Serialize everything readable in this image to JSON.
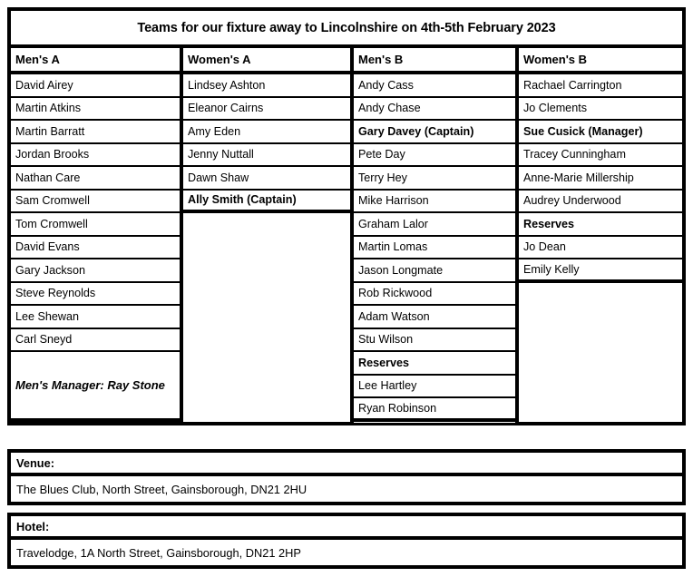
{
  "document": {
    "title": "Teams for our fixture away to Lincolnshire on 4th-5th February 2023"
  },
  "teams_table": {
    "columns": [
      {
        "header": "Men's A",
        "entries": [
          {
            "text": "David Airey",
            "bold": false
          },
          {
            "text": "Martin Atkins",
            "bold": false
          },
          {
            "text": "Martin Barratt",
            "bold": false
          },
          {
            "text": "Jordan Brooks",
            "bold": false
          },
          {
            "text": "Nathan Care",
            "bold": false
          },
          {
            "text": "Sam Cromwell",
            "bold": false
          },
          {
            "text": "Tom Cromwell",
            "bold": false
          },
          {
            "text": "David Evans",
            "bold": false
          },
          {
            "text": "Gary Jackson",
            "bold": false
          },
          {
            "text": "Steve Reynolds",
            "bold": false
          },
          {
            "text": "Lee Shewan",
            "bold": false
          },
          {
            "text": "Carl Sneyd",
            "bold": false
          }
        ],
        "manager_note": "Men's Manager: Ray Stone"
      },
      {
        "header": "Women's A",
        "entries": [
          {
            "text": "Lindsey Ashton",
            "bold": false
          },
          {
            "text": "Eleanor Cairns",
            "bold": false
          },
          {
            "text": "Amy Eden",
            "bold": false
          },
          {
            "text": "Jenny Nuttall",
            "bold": false
          },
          {
            "text": "Dawn Shaw",
            "bold": false
          },
          {
            "text": "Ally Smith (Captain)",
            "bold": true
          }
        ],
        "manager_note": null
      },
      {
        "header": "Men's B",
        "entries": [
          {
            "text": "Andy Cass",
            "bold": false
          },
          {
            "text": "Andy Chase",
            "bold": false
          },
          {
            "text": "Gary Davey (Captain)",
            "bold": true
          },
          {
            "text": "Pete Day",
            "bold": false
          },
          {
            "text": "Terry Hey",
            "bold": false
          },
          {
            "text": "Mike Harrison",
            "bold": false
          },
          {
            "text": "Graham Lalor",
            "bold": false
          },
          {
            "text": "Martin Lomas",
            "bold": false
          },
          {
            "text": "Jason Longmate",
            "bold": false
          },
          {
            "text": "Rob Rickwood",
            "bold": false
          },
          {
            "text": "Adam Watson",
            "bold": false
          },
          {
            "text": "Stu Wilson",
            "bold": false
          },
          {
            "text": "Reserves",
            "bold": true
          },
          {
            "text": "Lee Hartley",
            "bold": false
          },
          {
            "text": "Ryan Robinson",
            "bold": false
          }
        ],
        "manager_note": null
      },
      {
        "header": "Women's B",
        "entries": [
          {
            "text": "Rachael Carrington",
            "bold": false
          },
          {
            "text": "Jo Clements",
            "bold": false
          },
          {
            "text": "Sue Cusick (Manager)",
            "bold": true
          },
          {
            "text": "Tracey Cunningham",
            "bold": false
          },
          {
            "text": "Anne-Marie Millership",
            "bold": false
          },
          {
            "text": "Audrey Underwood",
            "bold": false
          },
          {
            "text": "Reserves",
            "bold": true
          },
          {
            "text": "Jo Dean",
            "bold": false
          },
          {
            "text": "Emily Kelly",
            "bold": false
          }
        ],
        "manager_note": null
      }
    ]
  },
  "venue": {
    "label": "Venue:",
    "value": "The Blues Club, North Street, Gainsborough, DN21 2HU"
  },
  "hotel": {
    "label": "Hotel:",
    "value": "Travelodge, 1A North Street, Gainsborough, DN21 2HP"
  }
}
